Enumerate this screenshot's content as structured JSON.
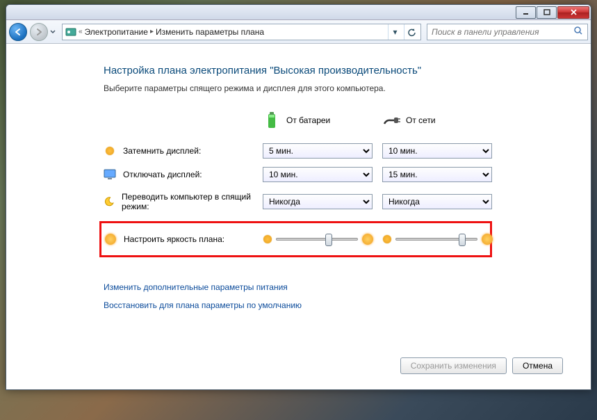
{
  "breadcrumb": {
    "item1": "Электропитание",
    "item2": "Изменить параметры плана"
  },
  "search": {
    "placeholder": "Поиск в панели управления"
  },
  "heading": "Настройка плана электропитания \"Высокая производительность\"",
  "subtitle": "Выберите параметры спящего режима и дисплея для этого компьютера.",
  "columns": {
    "battery": "От батареи",
    "ac": "От сети"
  },
  "rows": {
    "dim": "Затемнить дисплей:",
    "off": "Отключать дисплей:",
    "sleep": "Переводить компьютер в спящий режим:",
    "brightness": "Настроить яркость плана:"
  },
  "values": {
    "dim_battery": "5 мин.",
    "dim_ac": "10 мин.",
    "off_battery": "10 мин.",
    "off_ac": "15 мин.",
    "sleep_battery": "Никогда",
    "sleep_ac": "Никогда",
    "brightness_battery_pct": 60,
    "brightness_ac_pct": 78
  },
  "links": {
    "advanced": "Изменить дополнительные параметры питания",
    "restore": "Восстановить для плана параметры по умолчанию"
  },
  "buttons": {
    "save": "Сохранить изменения",
    "cancel": "Отмена"
  }
}
